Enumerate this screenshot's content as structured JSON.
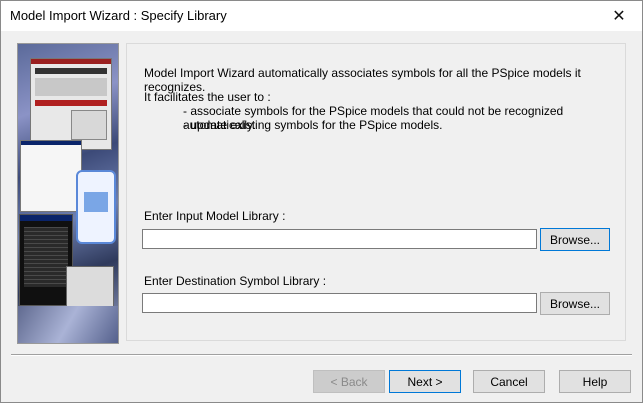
{
  "window": {
    "title": "Model Import Wizard : Specify Library",
    "close_glyph": "✕"
  },
  "panel": {
    "intro": "Model Import Wizard automatically associates symbols for all the PSpice models it recognizes.",
    "facilitates": "It facilitates the user to :",
    "bullets": [
      "- associate symbols for the PSpice models that could not be recognized automatically.",
      "- update existing symbols for the PSpice models."
    ],
    "input_label": "Enter Input Model Library :",
    "input_value": "",
    "input_browse": "Browse...",
    "dest_label": "Enter Destination Symbol Library :",
    "dest_value": "",
    "dest_browse": "Browse..."
  },
  "footer": {
    "back": "< Back",
    "next": "Next >",
    "cancel": "Cancel",
    "help": "Help"
  },
  "colors": {
    "focus_border": "#0078d7",
    "disabled_text": "#8a8a8a"
  }
}
